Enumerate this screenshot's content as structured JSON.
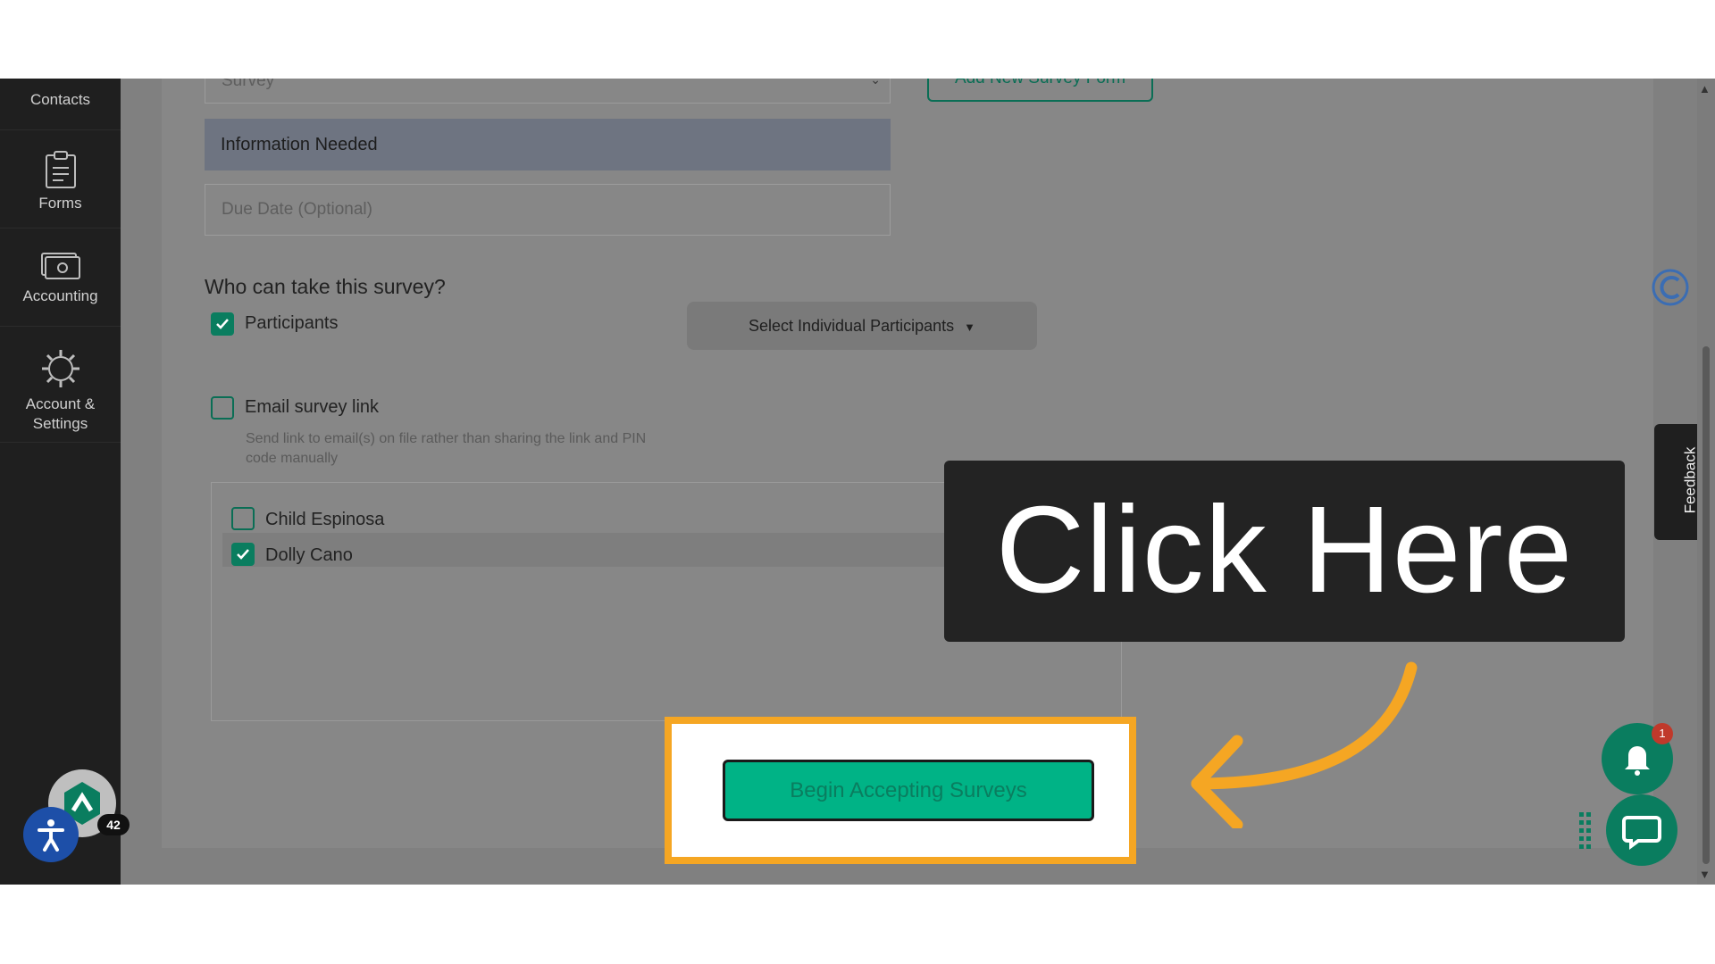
{
  "sidebar": {
    "items": [
      {
        "label": "Contacts",
        "icon": "contacts-icon"
      },
      {
        "label": "Forms",
        "icon": "clipboard-icon"
      },
      {
        "label": "Accounting",
        "icon": "money-icon"
      },
      {
        "label": "Account & Settings",
        "icon": "gear-icon"
      }
    ],
    "avatar_badge": "42"
  },
  "form": {
    "survey_select_value": "Survey",
    "add_new_label": "Add New Survey Form",
    "info_needed_label": "Information Needed",
    "due_date_placeholder": "Due Date (Optional)",
    "who_heading": "Who can take this survey?",
    "participants_label": "Participants",
    "participants_checked": true,
    "select_individual_label": "Select Individual Participants",
    "email_label": "Email survey link",
    "email_checked": false,
    "email_help": "Send link to email(s) on file rather than sharing the link and PIN code manually",
    "participants_list": [
      {
        "name": "Child Espinosa",
        "checked": false
      },
      {
        "name": "Dolly Cano",
        "checked": true
      }
    ],
    "begin_button_label": "Begin Accepting Surveys"
  },
  "overlay": {
    "callout_text": "Click Here"
  },
  "widgets": {
    "feedback_label": "Feedback",
    "bell_badge": "1"
  },
  "colors": {
    "accent": "#0a7d5f",
    "highlight": "#f5a623",
    "button": "#00b386",
    "sidebar": "#1f1f1f"
  }
}
